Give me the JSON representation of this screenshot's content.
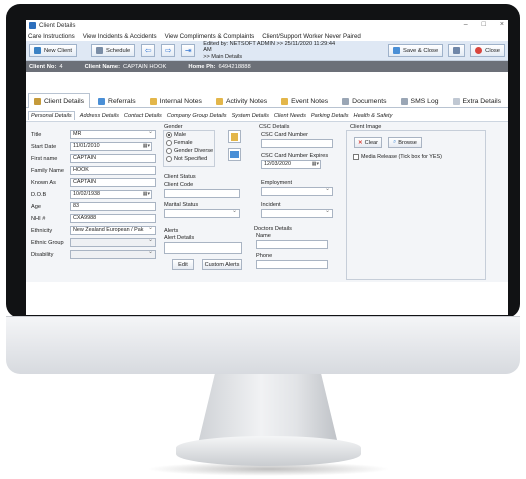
{
  "window": {
    "title": "Client Details",
    "minimize": "–",
    "maximize": "□",
    "close": "×"
  },
  "menu": [
    "Care Instructions",
    "View Incidents & Accidents",
    "View Compliments & Complaints",
    "Client/Support Worker Never Paired"
  ],
  "toolbar": {
    "new_client": "New Client",
    "schedule": "Schedule",
    "edited_line1": "Edited by: NETSOFT ADMIN >> 25/11/2020 11:29:44 AM",
    "edited_line2": ">> Main Details",
    "save_close": "Save & Close",
    "close": "Close"
  },
  "infobar": {
    "client_no_label": "Client No:",
    "client_no": "4",
    "client_name_label": "Client Name:",
    "client_name": "CAPTAIN HOOK",
    "home_ph_label": "Home Ph:",
    "home_ph": "6494218888"
  },
  "tabs": [
    "Client Details",
    "Referrals",
    "Internal Notes",
    "Activity Notes",
    "Event Notes",
    "Documents",
    "SMS Log",
    "Extra Details"
  ],
  "subtabs": [
    "Personal Details",
    "Address Details",
    "Contact Details",
    "Company Group Details",
    "System Details",
    "Client Needs",
    "Parking Details",
    "Health & Safety"
  ],
  "personal": {
    "title_label": "Title",
    "title": "MR",
    "start_label": "Start Date",
    "start": "11/01/2010",
    "first_label": "First name",
    "first": "CAPTAIN",
    "family_label": "Family Name",
    "family": "HOOK",
    "known_label": "Known As",
    "known": "CAPTAIN",
    "dob_label": "D.O.B",
    "dob": "10/02/1938",
    "age_label": "Age",
    "age": "83",
    "nhi_label": "NHI #",
    "nhi": "CXA9988",
    "eth_label": "Ethnicity",
    "eth": "New Zealand European / Pak",
    "ethgrp_label": "Ethnic Group",
    "ethgrp": "",
    "dis_label": "Disability",
    "dis": ""
  },
  "gender": {
    "label": "Gender",
    "options": [
      "Male",
      "Female",
      "Gender Diverse",
      "Not Specified"
    ],
    "selected": 0
  },
  "client_status": {
    "label": "Client Status",
    "code_label": "Client Code",
    "code": "",
    "marital_label": "Marital Status",
    "marital": ""
  },
  "alerts": {
    "label": "Alerts",
    "details_label": "Alert Details",
    "edit": "Edit",
    "custom": "Custom Alerts"
  },
  "csc": {
    "label": "CSC Details",
    "num_label": "CSC Card Number",
    "num": "",
    "exp_label": "CSC Card Number Expires",
    "exp": "12/03/2020"
  },
  "employment": {
    "label": "Employment",
    "value": ""
  },
  "incident": {
    "label": "Incident",
    "value": ""
  },
  "doctors": {
    "label": "Doctors Details",
    "name_label": "Name",
    "name": "",
    "phone_label": "Phone",
    "phone": ""
  },
  "image": {
    "label": "Client Image",
    "clear": "Clear",
    "browse": "Browse",
    "media_release": "Media Release  (Tick box for YES)"
  }
}
